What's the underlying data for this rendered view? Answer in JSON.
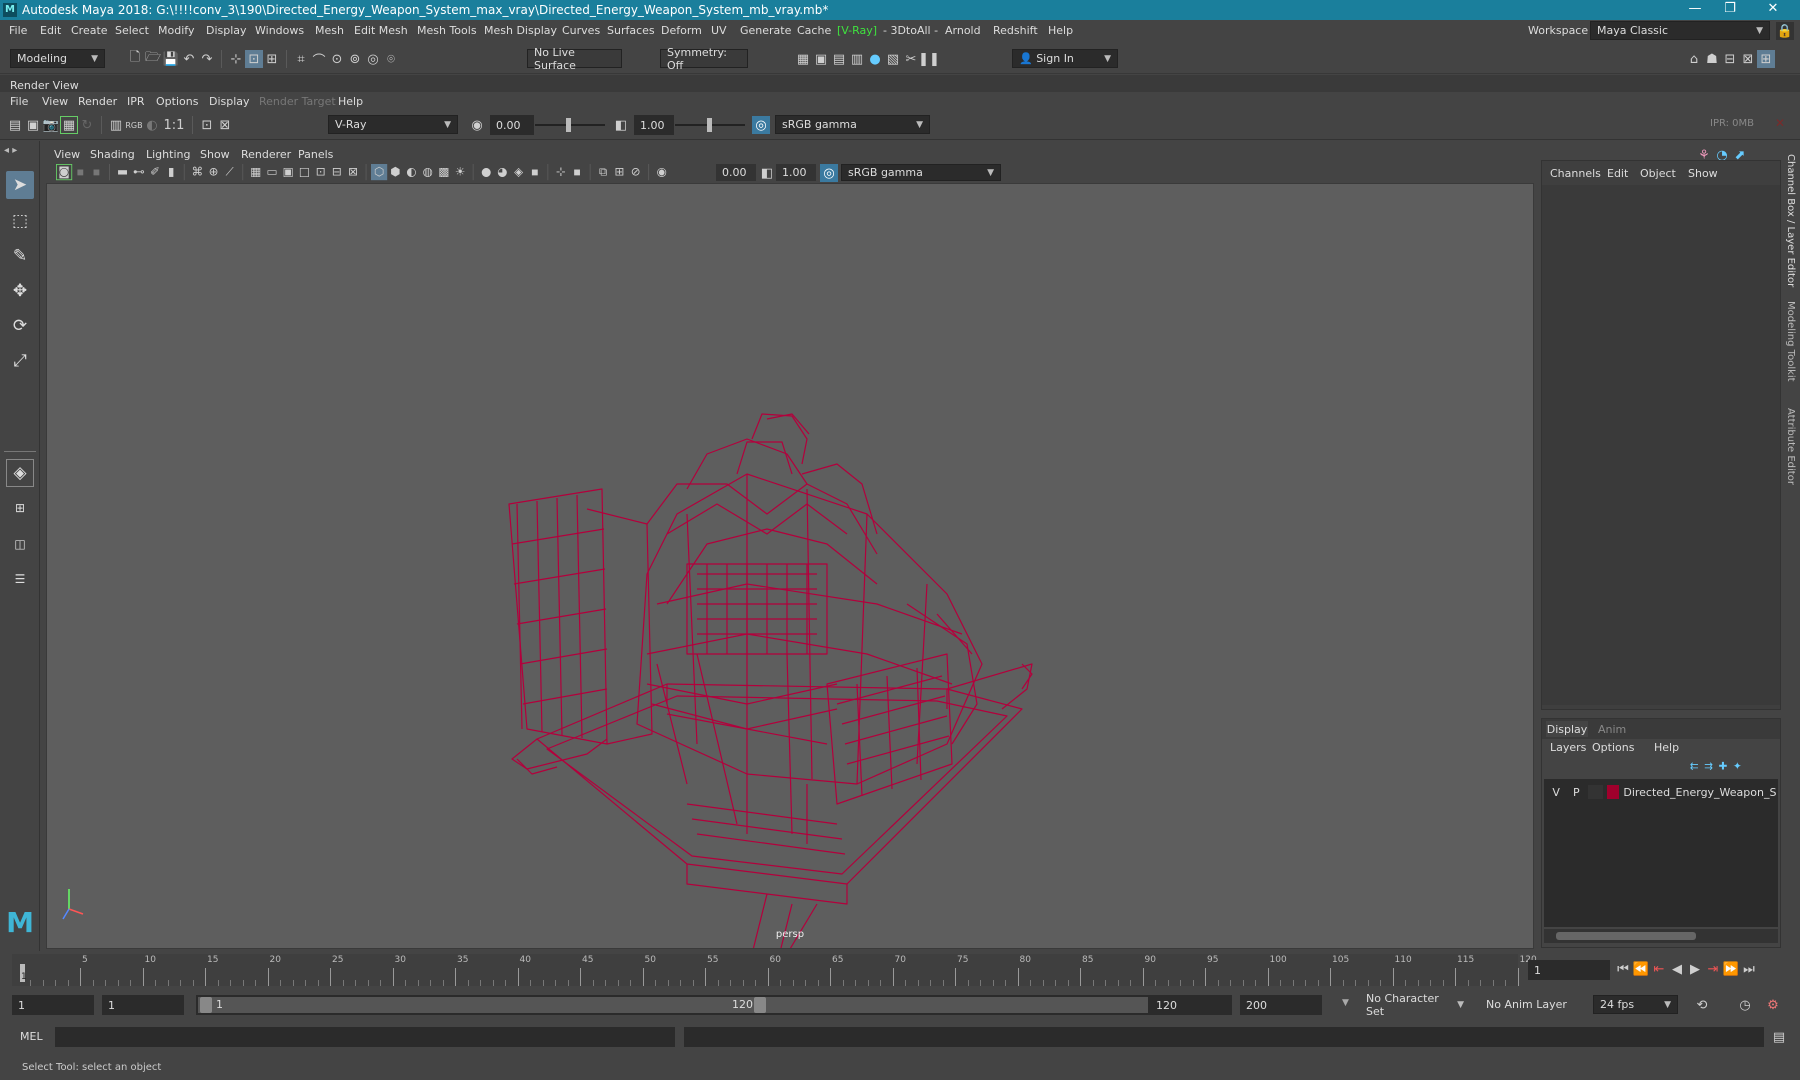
{
  "window": {
    "title": "Autodesk Maya 2018: G:\\!!!!conv_3\\190\\Directed_Energy_Weapon_System_max_vray\\Directed_Energy_Weapon_System_mb_vray.mb*",
    "logo": "M",
    "minimize": "—",
    "maximize": "❐",
    "close": "✕"
  },
  "menu": {
    "items": [
      "File",
      "Edit",
      "Create",
      "Select",
      "Modify",
      "Display",
      "Windows",
      "Mesh",
      "Edit Mesh",
      "Mesh Tools",
      "Mesh Display",
      "Curves",
      "Surfaces",
      "Deform",
      "UV",
      "Generate",
      "Cache",
      "[V-Ray]",
      "- 3DtoAll -",
      "Arnold",
      "Redshift",
      "Help"
    ],
    "vray_color": "#3fe23f",
    "workspace_label": "Workspace :",
    "workspace_value": "Maya Classic"
  },
  "statusline": {
    "mode": "Modeling",
    "live_surface": "No Live Surface",
    "symmetry": "Symmetry: Off",
    "sign_in": "Sign In"
  },
  "render_view": {
    "title": "Render View",
    "menu": [
      "File",
      "View",
      "Render",
      "IPR",
      "Options",
      "Display",
      "Render Target",
      "Help"
    ],
    "renderer": "V-Ray",
    "exposure": "0.00",
    "gamma": "1.00",
    "color_space": "sRGB gamma",
    "ratio": "1:1",
    "rgb": "RGB",
    "ipr_label": "IPR: 0MB"
  },
  "viewport": {
    "menu": [
      "View",
      "Shading",
      "Lighting",
      "Show",
      "Renderer",
      "Panels"
    ],
    "exposure": "0.00",
    "gamma": "1.00",
    "color_space": "sRGB gamma",
    "camera": "persp",
    "wire_color": "#b3003c",
    "bg_color": "#5e5e5e"
  },
  "channel_box": {
    "tabs": [
      "Channels",
      "Edit",
      "Object",
      "Show"
    ],
    "side_tabs": [
      "Channel Box / Layer Editor",
      "Modeling Toolkit",
      "Attribute Editor"
    ]
  },
  "layer_editor": {
    "tabs": [
      "Display",
      "Anim"
    ],
    "menu": [
      "Layers",
      "Options",
      "Help"
    ],
    "layer": {
      "v": "V",
      "p": "P",
      "name": "Directed_Energy_Weapon_Syst",
      "color": "#a0002c"
    }
  },
  "time_slider": {
    "ticks": [
      "5",
      "10",
      "15",
      "20",
      "25",
      "30",
      "35",
      "40",
      "45",
      "50",
      "55",
      "60",
      "65",
      "70",
      "75",
      "80",
      "85",
      "90",
      "95",
      "100",
      "105",
      "110",
      "115",
      "120"
    ],
    "start_marker": "1",
    "current_frame": "1"
  },
  "range_slider": {
    "start": "1",
    "anim_start": "1",
    "range_start": "1",
    "range_end": "120",
    "end": "120",
    "anim_end": "200",
    "character_set": "No Character Set",
    "anim_layer": "No Anim Layer",
    "fps": "24 fps"
  },
  "command_line": {
    "label": "MEL"
  },
  "help_line": {
    "text": "Select Tool: select an object"
  }
}
